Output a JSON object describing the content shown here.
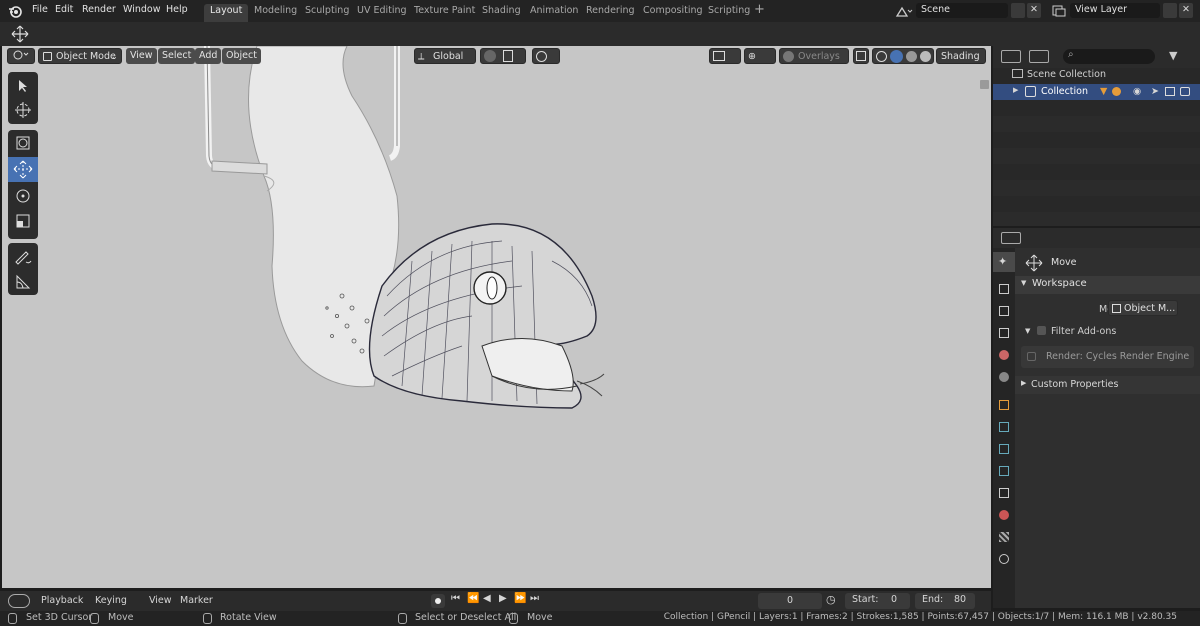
{
  "menus": [
    "File",
    "Edit",
    "Render",
    "Window",
    "Help"
  ],
  "workspaces": [
    "Layout",
    "Modeling",
    "Sculpting",
    "UV Editing",
    "Texture Paint",
    "Shading",
    "Animation",
    "Rendering",
    "Compositing",
    "Scripting"
  ],
  "scene": {
    "label": "Scene",
    "view_layer": "View Layer"
  },
  "viewport": {
    "mode": "Object Mode",
    "menus": [
      "View",
      "Select",
      "Add",
      "Object"
    ],
    "transform": "Global",
    "overlays": "Overlays",
    "shading": "Shading"
  },
  "outliner": {
    "scene_collection": "Scene Collection",
    "collection": "Collection"
  },
  "properties": {
    "tool": "Move",
    "workspace": "Workspace",
    "mode_label": "Mode",
    "mode_value": "Object M...",
    "filter_addons": "Filter Add-ons",
    "addon": "Render: Cycles Render Engine",
    "custom": "Custom Properties"
  },
  "timeline": {
    "menus": [
      "Playback",
      "Keying",
      "View",
      "Marker"
    ],
    "current": "0",
    "start_label": "Start:",
    "start": "0",
    "end_label": "End:",
    "end": "80"
  },
  "status": {
    "left": [
      "Set 3D Cursor",
      "Move",
      "Rotate View",
      "Select or Deselect All",
      "Move"
    ],
    "info": "Collection | GPencil | Layers:1 | Frames:2 | Strokes:1,585 | Points:67,457 | Objects:1/7 | Mem: 116.1 MB | v2.80.35"
  },
  "colors": {
    "accent": "#4772b3",
    "active_tab": "#3d3d3d",
    "viewport_bg": "#c6c6c6"
  }
}
